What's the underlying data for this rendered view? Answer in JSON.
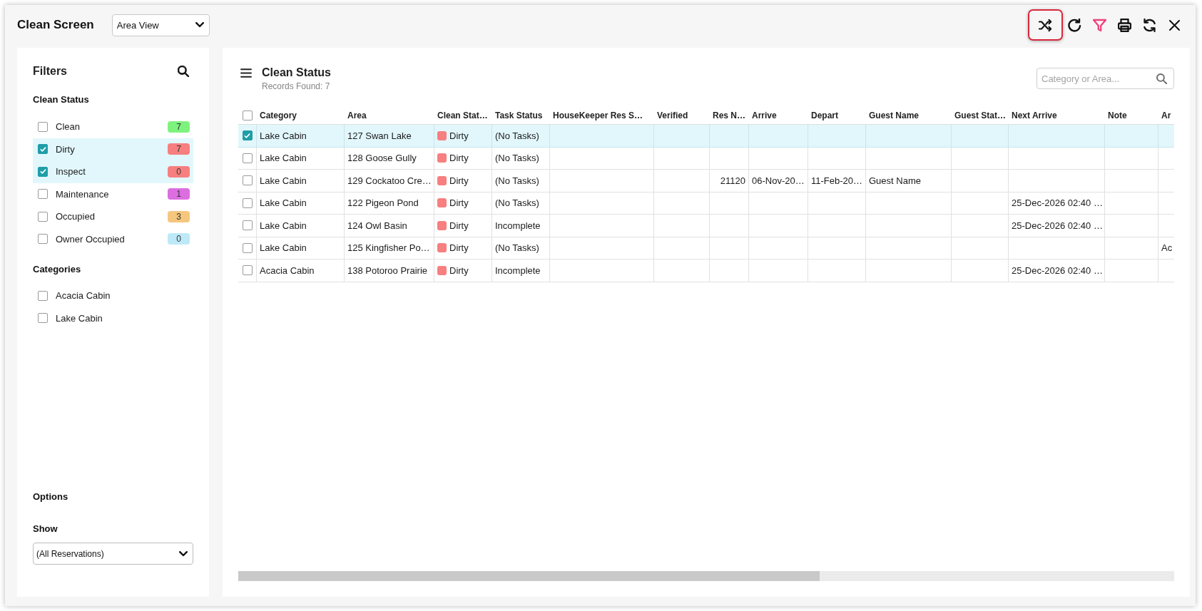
{
  "window": {
    "title": "Clean Screen",
    "view_select": "Area View"
  },
  "toolbar": [
    {
      "kind": "shuffle",
      "highlighted": true,
      "active": false
    },
    {
      "kind": "redo",
      "highlighted": false,
      "active": false
    },
    {
      "kind": "filter",
      "highlighted": false,
      "active": true
    },
    {
      "kind": "print",
      "highlighted": false,
      "active": false
    },
    {
      "kind": "refresh",
      "highlighted": false,
      "active": false
    },
    {
      "kind": "close",
      "highlighted": false,
      "active": false
    }
  ],
  "filters": {
    "title": "Filters",
    "sections": [
      {
        "heading": "Clean Status",
        "items": [
          {
            "label": "Clean",
            "count": "7",
            "color": "#7ef27e",
            "checked": false
          },
          {
            "label": "Dirty",
            "count": "7",
            "color": "#f77f7f",
            "checked": true
          },
          {
            "label": "Inspect",
            "count": "0",
            "color": "#f77f7f",
            "checked": true
          },
          {
            "label": "Maintenance",
            "count": "1",
            "color": "#dc6ee0",
            "checked": false
          },
          {
            "label": "Occupied",
            "count": "3",
            "color": "#f5c77e",
            "checked": false
          },
          {
            "label": "Owner Occupied",
            "count": "0",
            "color": "#bde9f8",
            "checked": false
          }
        ]
      },
      {
        "heading": "Categories",
        "items": [
          {
            "label": "Acacia Cabin",
            "checked": false
          },
          {
            "label": "Lake Cabin",
            "checked": false
          }
        ]
      }
    ],
    "options": {
      "heading": "Options",
      "show": {
        "label": "Show",
        "value": "(All Reservations)"
      }
    }
  },
  "main": {
    "title": "Clean Status",
    "records": "Records Found: 7",
    "search": {
      "placeholder": "Category or Area..."
    },
    "table": {
      "all_selected": false,
      "columns": [
        "Category",
        "Area",
        "Clean Stat…",
        "Task Status",
        "HouseKeeper Res S…",
        "Verified",
        "Res N…",
        "Arrive",
        "Depart",
        "Guest Name",
        "Guest Stat…",
        "Next Arrive",
        "Note",
        "Ar"
      ],
      "rows": [
        {
          "selected": true,
          "category": "Lake Cabin",
          "area": "127 Swan Lake",
          "clean_status": "Dirty",
          "color": "#f77f7f",
          "task_status": "(No Tasks)"
        },
        {
          "selected": false,
          "category": "Lake Cabin",
          "area": "128 Goose Gully",
          "clean_status": "Dirty",
          "color": "#f77f7f",
          "task_status": "(No Tasks)"
        },
        {
          "selected": false,
          "category": "Lake Cabin",
          "area": "129 Cockatoo Cre…",
          "clean_status": "Dirty",
          "color": "#f77f7f",
          "task_status": "(No Tasks)",
          "res_no": "21120",
          "arrive": "06-Nov-20…",
          "depart": "11-Feb-20…",
          "guest_name": "Guest Name"
        },
        {
          "selected": false,
          "category": "Lake Cabin",
          "area": "122 Pigeon Pond",
          "clean_status": "Dirty",
          "color": "#f77f7f",
          "task_status": "(No Tasks)",
          "next_arrive": "25-Dec-2026 02:40 …"
        },
        {
          "selected": false,
          "category": "Lake Cabin",
          "area": "124 Owl Basin",
          "clean_status": "Dirty",
          "color": "#f77f7f",
          "task_status": "Incomplete",
          "next_arrive": "25-Dec-2026 02:40 …"
        },
        {
          "selected": false,
          "category": "Lake Cabin",
          "area": "125 Kingfisher Po…",
          "clean_status": "Dirty",
          "color": "#f77f7f",
          "task_status": "(No Tasks)",
          "column_14": "Ac"
        },
        {
          "selected": false,
          "category": "Acacia Cabin",
          "area": "138 Potoroo Prairie",
          "clean_status": "Dirty",
          "color": "#f77f7f",
          "task_status": "Incomplete",
          "next_arrive": "25-Dec-2026 02:40 …"
        }
      ]
    }
  }
}
